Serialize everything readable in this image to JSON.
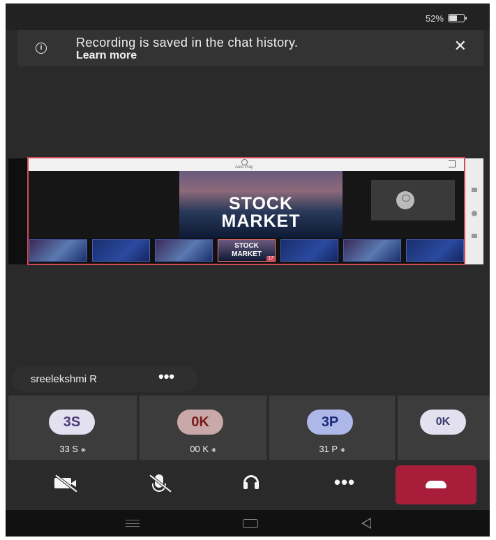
{
  "status_bar": {
    "battery_percent": "52%",
    "battery_level": 0.52
  },
  "banner": {
    "info_icon": "info-icon",
    "message": "Recording is saved in the chat history.",
    "link_text": "Learn more",
    "close_icon": "close-icon"
  },
  "shared_screen": {
    "autoplay_label": "Auto Play",
    "slide_title_line1": "STOCK",
    "slide_title_line2": "MARKET",
    "current_thumb_title_line1": "STOCK",
    "current_thumb_title_line2": "MARKET",
    "current_thumb_number": "17",
    "border_color": "#d24a5a"
  },
  "presenter": {
    "name": "sreelekshmi R",
    "more_label": "•••"
  },
  "participants": [
    {
      "initials": "3S",
      "label": "33 S",
      "avatar_color": "#e3e0f0",
      "text_color": "#4a3a7a"
    },
    {
      "initials": "0K",
      "label": "00 K",
      "avatar_color": "#c8a8a8",
      "text_color": "#7a1a1a"
    },
    {
      "initials": "3P",
      "label": "31 P",
      "avatar_color": "#aeb8e8",
      "text_color": "#1a2a7a"
    },
    {
      "initials": "0K",
      "label": "",
      "avatar_color": "#e3e0f0",
      "text_color": "#3a3a6a"
    }
  ],
  "controls": {
    "camera_icon": "camera-off-icon",
    "mic_icon": "mic-off-icon",
    "audio_icon": "headset-icon",
    "more_label": "•••",
    "hangup_icon": "phone-hangup-icon",
    "hangup_color": "#a71d3a"
  },
  "mute_glyph": "🔇"
}
